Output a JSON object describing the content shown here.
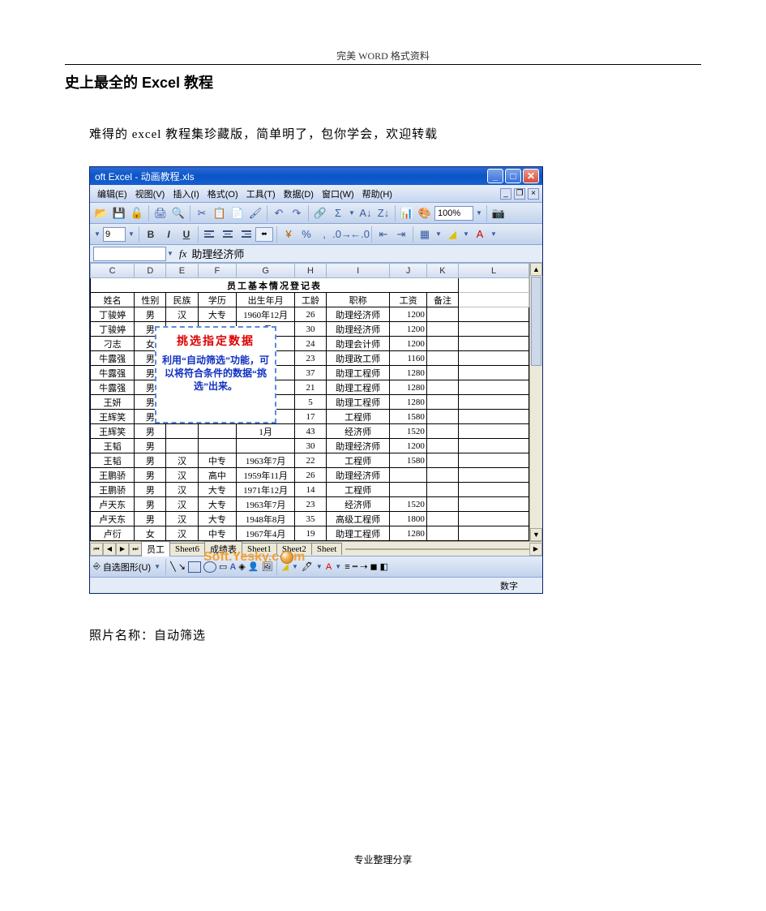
{
  "header": "完美 WORD 格式资料",
  "title": "史上最全的 Excel 教程",
  "intro": "难得的 excel 教程集珍藏版，简单明了，包你学会，欢迎转载",
  "caption": "照片名称：自动筛选",
  "footer": "专业整理分享",
  "excel": {
    "window_title": "oft Excel - 动画教程.xls",
    "menus": [
      "编辑(E)",
      "视图(V)",
      "插入(I)",
      "格式(O)",
      "工具(T)",
      "数据(D)",
      "窗口(W)",
      "帮助(H)"
    ],
    "zoom": "100%",
    "font_size": "9",
    "formula": "助理经济师",
    "columns": [
      "C",
      "D",
      "E",
      "F",
      "G",
      "H",
      "I",
      "J",
      "K",
      "L"
    ],
    "table_title": "员工基本情况登记表",
    "headers": [
      "姓名",
      "性别",
      "民族",
      "学历",
      "出生年月",
      "工龄",
      "职称",
      "工资",
      "备注"
    ],
    "rows": [
      [
        "丁骏婷",
        "男",
        "汉",
        "大专",
        "1960年12月",
        "26",
        "助理经济师",
        "1200",
        ""
      ],
      [
        "丁骏婷",
        "男",
        "",
        "",
        "2月",
        "30",
        "助理经济师",
        "1200",
        ""
      ],
      [
        "刁志",
        "女",
        "",
        "",
        "月",
        "24",
        "助理会计师",
        "1200",
        ""
      ],
      [
        "牛露强",
        "男",
        "",
        "",
        "月",
        "23",
        "助理政工师",
        "1160",
        ""
      ],
      [
        "牛露强",
        "男",
        "",
        "",
        "2月",
        "37",
        "助理工程师",
        "1280",
        ""
      ],
      [
        "牛露强",
        "男",
        "",
        "",
        "月",
        "21",
        "助理工程师",
        "1280",
        ""
      ],
      [
        "王妍",
        "男",
        "",
        "",
        "2月",
        "5",
        "助理工程师",
        "1280",
        ""
      ],
      [
        "王辉笑",
        "男",
        "",
        "",
        "2月",
        "17",
        "工程师",
        "1580",
        ""
      ],
      [
        "王辉笑",
        "男",
        "",
        "",
        "1月",
        "43",
        "经济师",
        "1520",
        ""
      ],
      [
        "王韬",
        "男",
        "",
        "",
        "",
        "30",
        "助理经济师",
        "1200",
        ""
      ],
      [
        "王韬",
        "男",
        "汉",
        "中专",
        "1963年7月",
        "22",
        "工程师",
        "1580",
        ""
      ],
      [
        "王鹏骄",
        "男",
        "汉",
        "高中",
        "1959年11月",
        "26",
        "助理经济师",
        "",
        ""
      ],
      [
        "王鹏骄",
        "男",
        "汉",
        "大专",
        "1971年12月",
        "14",
        "工程师",
        "",
        ""
      ],
      [
        "卢天东",
        "男",
        "汉",
        "大专",
        "1963年7月",
        "23",
        "经济师",
        "1520",
        ""
      ],
      [
        "卢天东",
        "男",
        "汉",
        "大专",
        "1948年8月",
        "35",
        "高级工程师",
        "1800",
        ""
      ],
      [
        "卢衍",
        "女",
        "汉",
        "中专",
        "1967年4月",
        "19",
        "助理工程师",
        "1280",
        ""
      ]
    ],
    "tip": {
      "title": "挑选指定数据",
      "body": "利用“自动筛选”功能，可以将符合条件的数据“挑选”出来。"
    },
    "watermark": "Soft.Yesky.c",
    "sheet_tabs": [
      "员工",
      "Sheet6",
      "成绩表",
      "Sheet1",
      "Sheet2",
      "Sheet"
    ],
    "drawing_label": "自选图形(U)",
    "status": "数字"
  }
}
